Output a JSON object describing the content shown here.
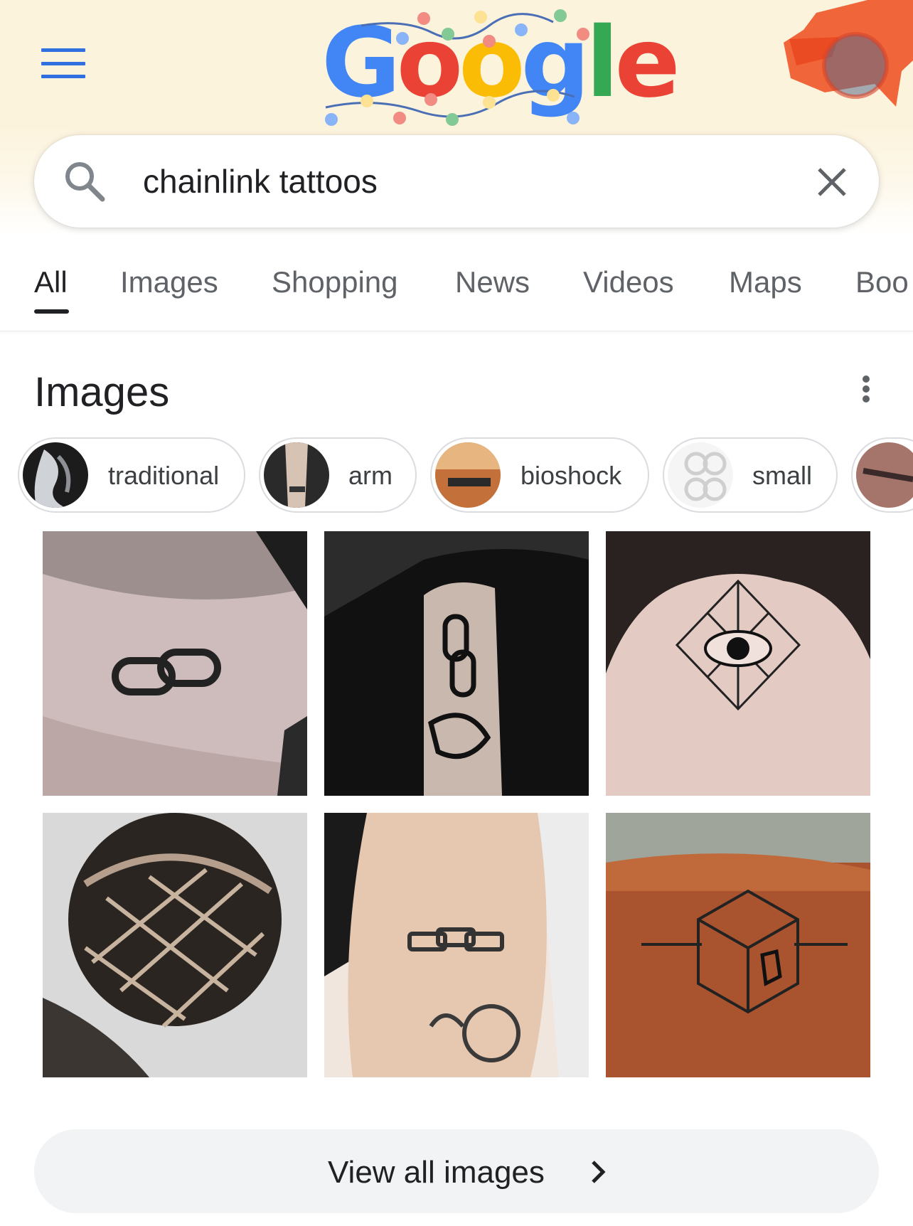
{
  "header": {
    "menu_icon": "hamburger-menu-icon",
    "logo_text": "Google",
    "logo_letters": [
      {
        "char": "G",
        "color": "#4285f4"
      },
      {
        "char": "o",
        "color": "#ea4335"
      },
      {
        "char": "o",
        "color": "#fbbc05"
      },
      {
        "char": "g",
        "color": "#4285f4"
      },
      {
        "char": "l",
        "color": "#34a853"
      },
      {
        "char": "e",
        "color": "#ea4335"
      }
    ],
    "avatar_icon": "account-avatar-icon"
  },
  "search": {
    "query": "chainlink tattoos",
    "search_icon": "search-icon",
    "clear_icon": "close-icon"
  },
  "tabs": [
    {
      "label": "All",
      "active": true
    },
    {
      "label": "Images",
      "active": false
    },
    {
      "label": "Shopping",
      "active": false
    },
    {
      "label": "News",
      "active": false
    },
    {
      "label": "Videos",
      "active": false
    },
    {
      "label": "Maps",
      "active": false
    },
    {
      "label": "Boo",
      "active": false
    }
  ],
  "images_section": {
    "title": "Images",
    "more_icon": "more-vert-icon",
    "chips": [
      {
        "label": "traditional"
      },
      {
        "label": "arm"
      },
      {
        "label": "bioshock"
      },
      {
        "label": "small"
      },
      {
        "label": ""
      }
    ],
    "view_all_label": "View all images",
    "view_all_icon": "chevron-right-icon"
  },
  "colors": {
    "accent_blue": "#2f6fe0",
    "header_bg": "#fcf3dc",
    "text_primary": "#202124",
    "text_secondary": "#5f6368",
    "button_bg": "#f1f3f4"
  }
}
